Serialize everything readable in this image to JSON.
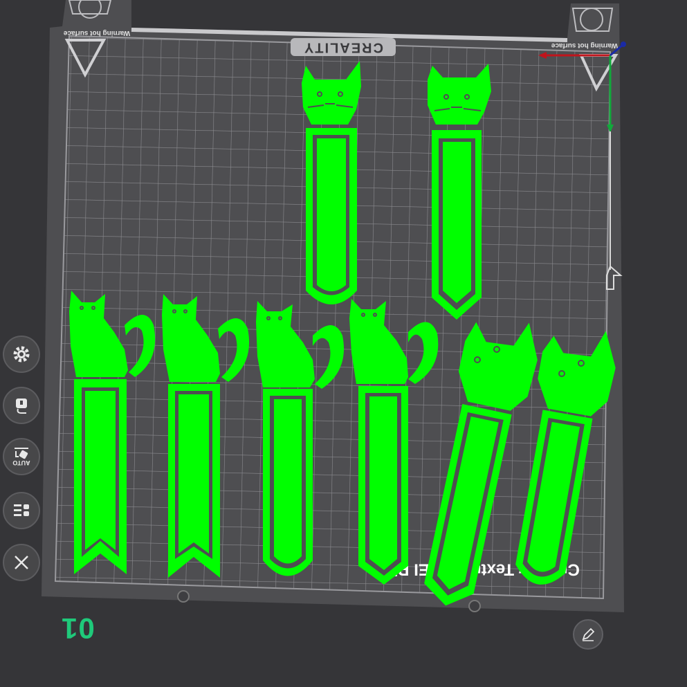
{
  "plate": {
    "brand_label": "CREALITY",
    "warning_left": "Warning hot surface",
    "warning_right": "Warning hot surface",
    "plate_type_label": "Creality Textured PEI Plate",
    "plate_number": "01"
  },
  "left_toolbar": {
    "buttons": [
      {
        "name": "settings",
        "icon": "gear-icon"
      },
      {
        "name": "filament",
        "icon": "filament-icon"
      },
      {
        "name": "auto-arrange",
        "icon": "auto-arrange-icon",
        "label": "AUTO"
      },
      {
        "name": "object-list",
        "icon": "list-icon"
      },
      {
        "name": "close",
        "icon": "close-icon"
      }
    ]
  },
  "colors": {
    "background": "#353538",
    "bed": "#4e4e51",
    "grid": "#8a8a8e",
    "model": "#00ff00",
    "accent": "#1fc97a",
    "axis_x": "#c0141c",
    "axis_y": "#11a93b",
    "axis_z": "#1a2aa5"
  }
}
